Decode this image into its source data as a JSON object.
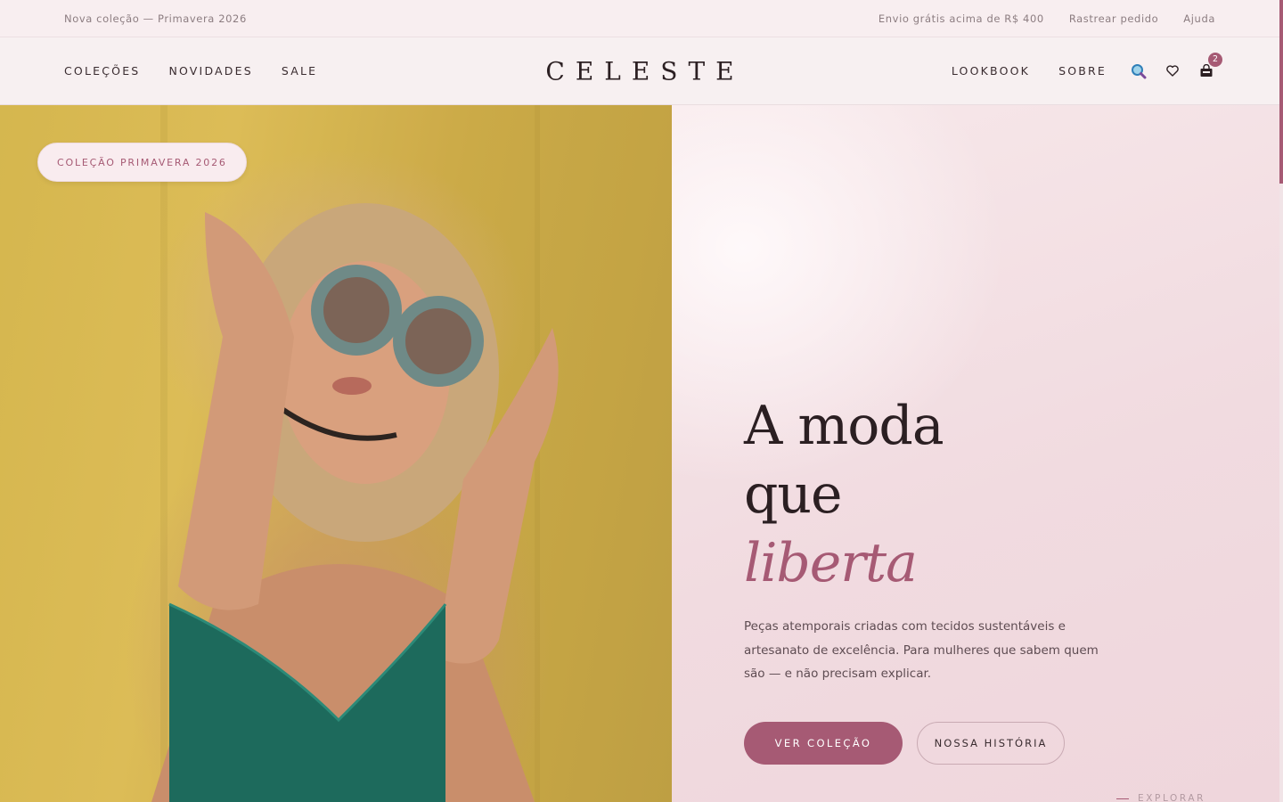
{
  "topbar": {
    "announcement": "Nova coleção — Primavera 2026",
    "links": [
      "Envio grátis acima de R$ 400",
      "Rastrear pedido",
      "Ajuda"
    ]
  },
  "header": {
    "logo": "CELESTE",
    "nav_left": [
      "COLEÇÕES",
      "NOVIDADES",
      "SALE"
    ],
    "nav_right": [
      "LOOKBOOK",
      "SOBRE"
    ],
    "icons": [
      "search-icon",
      "heart-icon",
      "bag-icon"
    ],
    "cart_count": "2"
  },
  "hero": {
    "pill": "COLEÇÃO PRIMAVERA 2026",
    "headline_line1": "A moda",
    "headline_line2": "que",
    "headline_accent": "liberta",
    "subtext": "Peças atemporais criadas com tecidos sustentáveis e artesanato de excelência. Para mulheres que sabem quem são — e não precisam explicar.",
    "primary_cta": "VER COLEÇÃO",
    "secondary_cta": "NOSSA HISTÓRIA",
    "explore": "EXPLORAR"
  },
  "colors": {
    "accent": "#a65a74",
    "background": "#f9eff1",
    "text": "#2b1f22"
  }
}
